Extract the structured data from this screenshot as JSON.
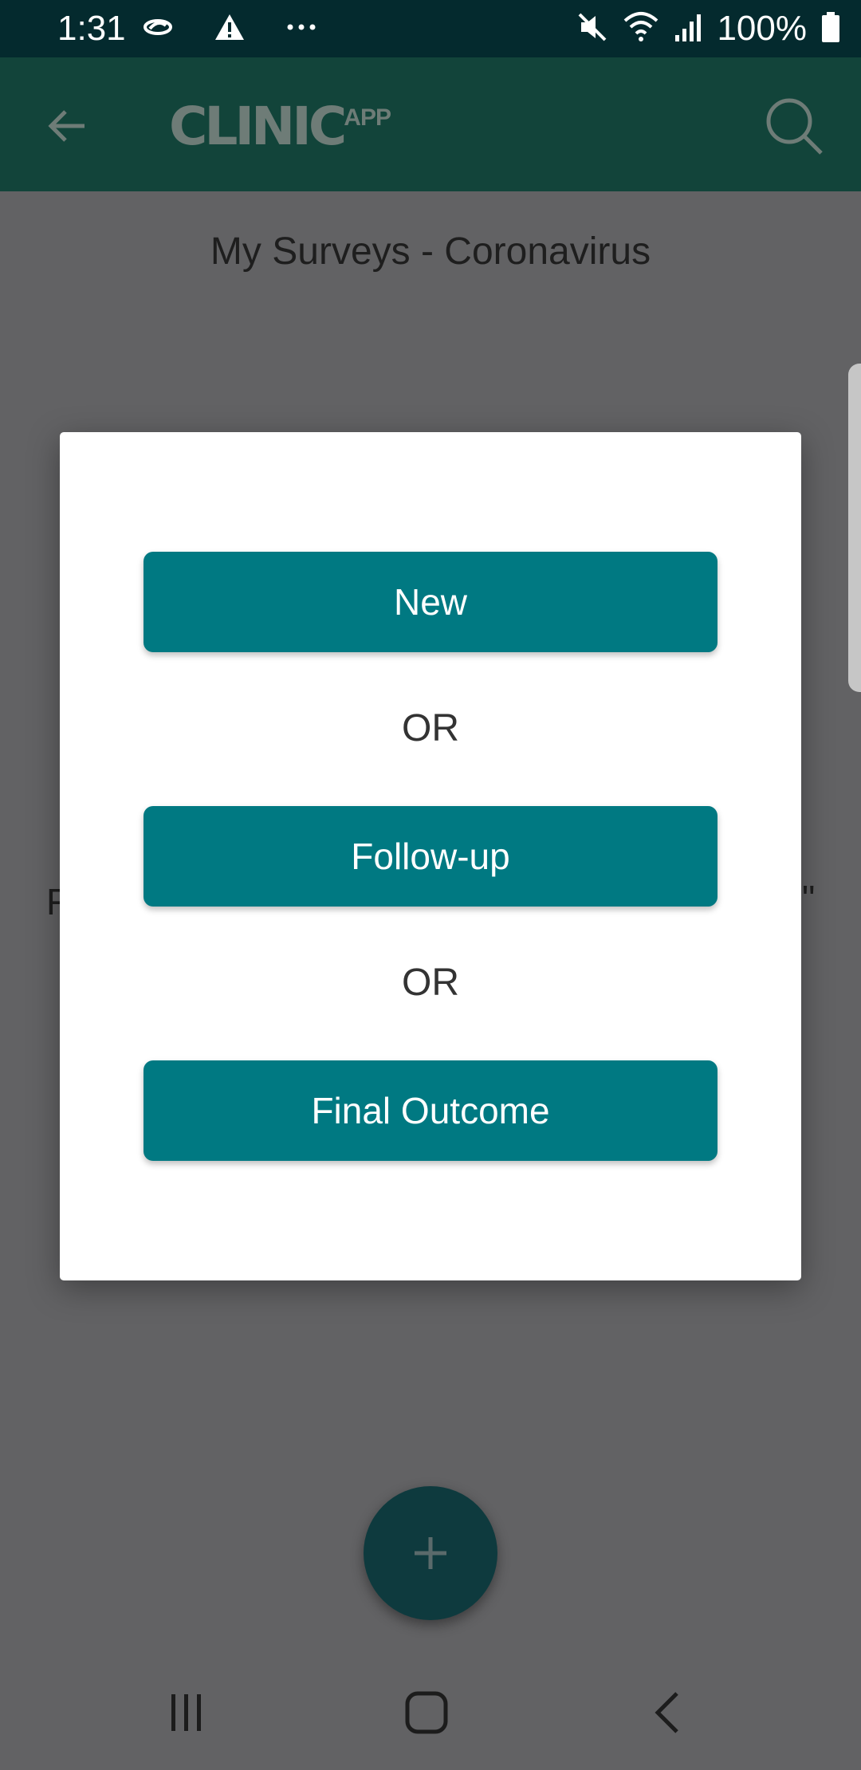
{
  "status_bar": {
    "time": "1:31",
    "battery_percent": "100%",
    "icons": [
      "sync-icon",
      "warning-icon",
      "more-icon",
      "mute-icon",
      "wifi-icon",
      "signal-icon",
      "battery-icon"
    ]
  },
  "app_bar": {
    "logo_main": "CLINIC",
    "logo_sup": "APP",
    "back_icon": "arrow-back-icon",
    "search_icon": "search-icon"
  },
  "page": {
    "title": "My Surveys - Coronavirus",
    "obscured_text_left": "F",
    "obscured_text_right": "\""
  },
  "dialog": {
    "new_label": "New",
    "or_label_1": "OR",
    "follow_up_label": "Follow-up",
    "or_label_2": "OR",
    "final_outcome_label": "Final Outcome"
  },
  "fab": {
    "icon": "plus-icon"
  },
  "nav_bar": {
    "icons": [
      "recent-apps-icon",
      "home-icon",
      "back-icon"
    ]
  },
  "colors": {
    "status_bar": "#042a2e",
    "app_bar": "#12443a",
    "dialog_button": "#007982",
    "scrim": "#626264",
    "fab": "#0e3a3e"
  }
}
